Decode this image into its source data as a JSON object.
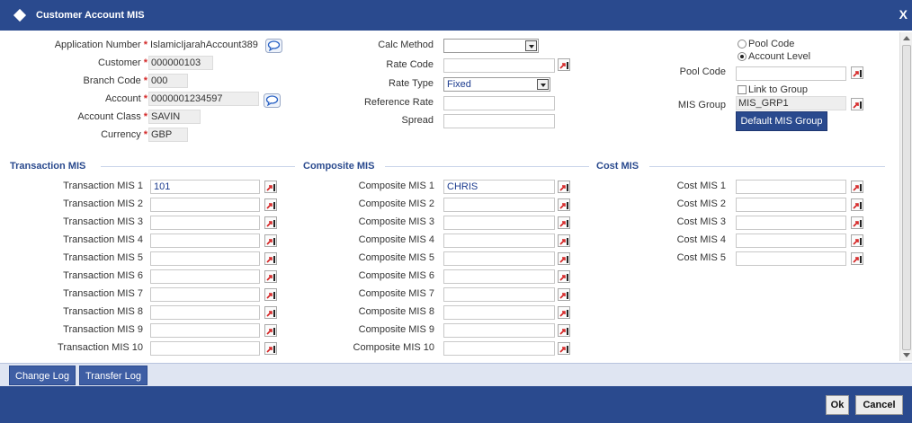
{
  "window": {
    "title": "Customer Account MIS",
    "close_label": "X"
  },
  "account": {
    "application_number_label": "Application Number",
    "application_number_value": "IslamicIjarahAccount389",
    "customer_label": "Customer",
    "customer_value": "000000103",
    "branch_code_label": "Branch Code",
    "branch_code_value": "000",
    "account_label": "Account",
    "account_value": "0000001234597",
    "account_class_label": "Account Class",
    "account_class_value": "SAVIN",
    "currency_label": "Currency",
    "currency_value": "GBP",
    "required_marker": "*"
  },
  "rates": {
    "calc_method_label": "Calc Method",
    "calc_method_value": "",
    "rate_code_label": "Rate Code",
    "rate_code_value": "",
    "rate_type_label": "Rate Type",
    "rate_type_value": "Fixed",
    "reference_rate_label": "Reference Rate",
    "reference_rate_value": "",
    "spread_label": "Spread",
    "spread_value": ""
  },
  "pool": {
    "pool_code_option": "Pool Code",
    "account_level_option": "Account Level",
    "selected_option": "Account Level",
    "pool_code_label": "Pool Code",
    "pool_code_value": "",
    "link_to_group_label": "Link to Group",
    "link_to_group_checked": false,
    "mis_group_label": "MIS Group",
    "mis_group_value": "MIS_GRP1",
    "default_mis_group_button": "Default MIS Group"
  },
  "transaction_mis": {
    "title": "Transaction MIS",
    "rows": [
      {
        "label": "Transaction MIS 1",
        "value": "101"
      },
      {
        "label": "Transaction MIS 2",
        "value": ""
      },
      {
        "label": "Transaction MIS 3",
        "value": ""
      },
      {
        "label": "Transaction MIS 4",
        "value": ""
      },
      {
        "label": "Transaction MIS 5",
        "value": ""
      },
      {
        "label": "Transaction MIS 6",
        "value": ""
      },
      {
        "label": "Transaction MIS 7",
        "value": ""
      },
      {
        "label": "Transaction MIS 8",
        "value": ""
      },
      {
        "label": "Transaction MIS 9",
        "value": ""
      },
      {
        "label": "Transaction MIS 10",
        "value": ""
      }
    ]
  },
  "composite_mis": {
    "title": "Composite MIS",
    "rows": [
      {
        "label": "Composite MIS 1",
        "value": "CHRIS"
      },
      {
        "label": "Composite MIS 2",
        "value": ""
      },
      {
        "label": "Composite MIS 3",
        "value": ""
      },
      {
        "label": "Composite MIS 4",
        "value": ""
      },
      {
        "label": "Composite MIS 5",
        "value": ""
      },
      {
        "label": "Composite MIS 6",
        "value": ""
      },
      {
        "label": "Composite MIS 7",
        "value": ""
      },
      {
        "label": "Composite MIS 8",
        "value": ""
      },
      {
        "label": "Composite MIS 9",
        "value": ""
      },
      {
        "label": "Composite MIS 10",
        "value": ""
      }
    ]
  },
  "cost_mis": {
    "title": "Cost MIS",
    "rows": [
      {
        "label": "Cost MIS 1",
        "value": ""
      },
      {
        "label": "Cost MIS 2",
        "value": ""
      },
      {
        "label": "Cost MIS 3",
        "value": ""
      },
      {
        "label": "Cost MIS 4",
        "value": ""
      },
      {
        "label": "Cost MIS 5",
        "value": ""
      }
    ]
  },
  "tabs": [
    {
      "label": "Change Log"
    },
    {
      "label": "Transfer Log"
    }
  ],
  "footer": {
    "ok_label": "Ok",
    "cancel_label": "Cancel"
  },
  "icons": {
    "lov": "search-lov-icon",
    "message": "speech-bubble-icon",
    "dropdown": "chevron-down-icon"
  },
  "colors": {
    "header_blue": "#2a4a8e",
    "required_red": "#d32a2a",
    "section_title": "#2a4a8e",
    "lov_arrow": "#d42020"
  }
}
